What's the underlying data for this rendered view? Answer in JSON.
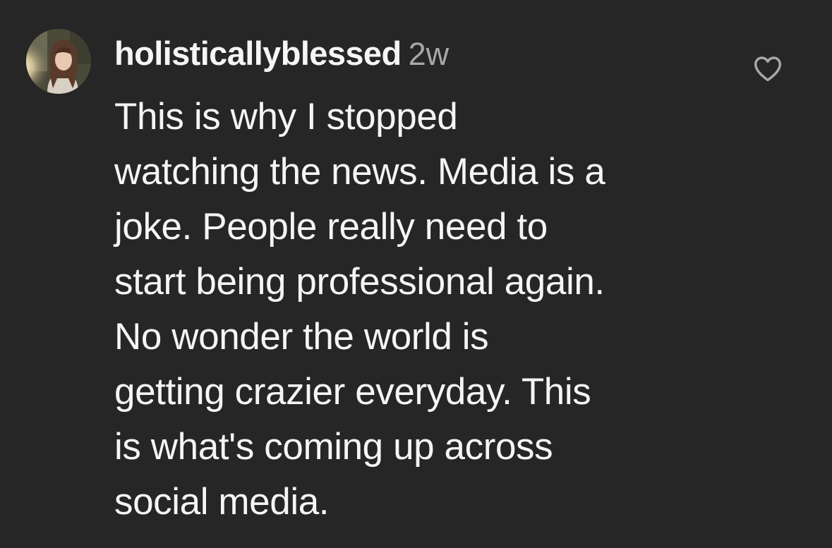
{
  "comment": {
    "username": "holisticallyblessed",
    "timestamp": "2w",
    "lines": [
      "This is why I stopped",
      "watching the news. Media is a",
      "joke. People really need to",
      "start being professional again.",
      "No wonder the world is",
      "getting crazier everyday. This",
      "is what's coming up across",
      "social media."
    ],
    "like_icon": "heart-outline-icon"
  },
  "colors": {
    "background": "#262626",
    "text_primary": "#f5f5f5",
    "text_secondary": "#a8a8a8"
  }
}
